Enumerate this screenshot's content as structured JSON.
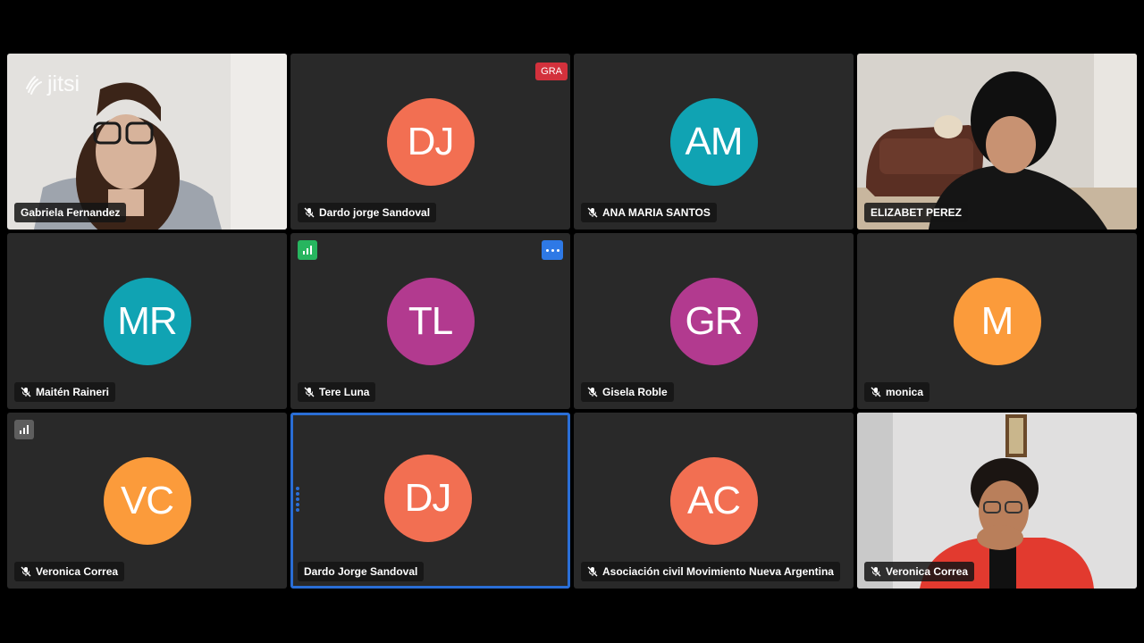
{
  "app": {
    "logo_text": "jitsi",
    "recording_badge": "GRA"
  },
  "colors": {
    "tile_bg": "#292929",
    "active_border": "#2a6ed6",
    "avatar_coral": "#f26f52",
    "avatar_teal": "#10a3b3",
    "avatar_magenta": "#b23a8f",
    "avatar_orange": "#fb9b3b",
    "signal_good": "#27b55f",
    "signal_weak": "#5e5e5e",
    "more_button": "#2e79e6",
    "recording_red": "#d3313c"
  },
  "participants": [
    {
      "name": "Gabriela Fernandez",
      "initials": "",
      "muted": false,
      "video": true
    },
    {
      "name": "Dardo jorge Sandoval",
      "initials": "DJ",
      "muted": true,
      "video": false
    },
    {
      "name": "ANA MARIA SANTOS",
      "initials": "AM",
      "muted": true,
      "video": false
    },
    {
      "name": "ELIZABET PEREZ",
      "initials": "",
      "muted": false,
      "video": true
    },
    {
      "name": "Maitén Raineri",
      "initials": "MR",
      "muted": true,
      "video": false
    },
    {
      "name": "Tere Luna",
      "initials": "TL",
      "muted": true,
      "video": false
    },
    {
      "name": "Gisela Roble",
      "initials": "GR",
      "muted": true,
      "video": false
    },
    {
      "name": "monica",
      "initials": "M",
      "muted": true,
      "video": false
    },
    {
      "name": "Veronica Correa",
      "initials": "VC",
      "muted": true,
      "video": false
    },
    {
      "name": "Dardo Jorge Sandoval",
      "initials": "DJ",
      "muted": false,
      "video": false,
      "active": true
    },
    {
      "name": "Asociación civil Movimiento Nueva Argentina",
      "initials": "AC",
      "muted": true,
      "video": false
    },
    {
      "name": "Veronica Correa",
      "initials": "",
      "muted": true,
      "video": true
    }
  ]
}
